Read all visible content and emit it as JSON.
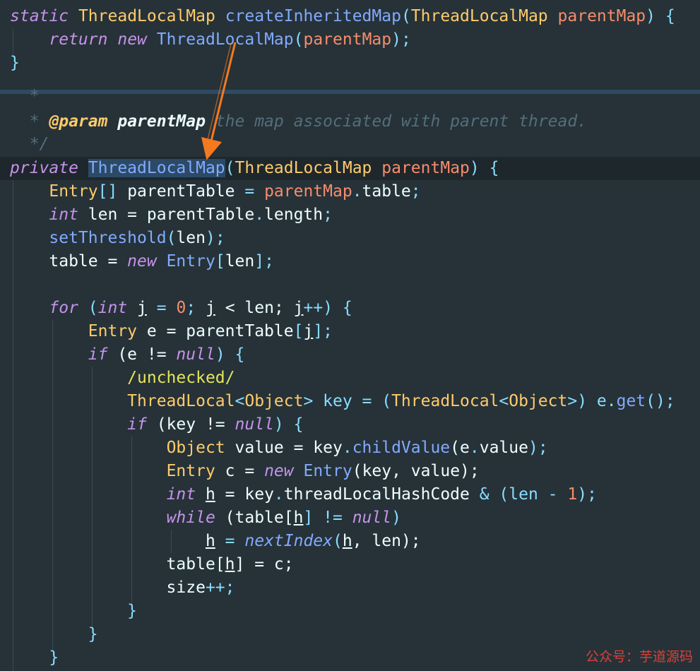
{
  "editor": {
    "theme_colors": {
      "background": "#263238",
      "keyword": "#c792ea",
      "type": "#ffcb6b",
      "function": "#82aaff",
      "param": "#f78c6c",
      "operator": "#89ddff",
      "comment": "#546e7a",
      "arrow": "#f4791f"
    },
    "lines": {
      "l1": {
        "a": "static",
        "b": " ",
        "c": "ThreadLocalMap",
        "d": " ",
        "e": "createInheritedMap",
        "f": "(",
        "g": "ThreadLocalMap",
        "h": " ",
        "i": "parentMap",
        "j": ") {"
      },
      "l2": {
        "a": "    ",
        "b": "return",
        "c": " ",
        "d": "new",
        "e": " ",
        "f": "ThreadLocalMap",
        "g": "(",
        "h": "parentMap",
        "i": ");"
      },
      "l3": {
        "a": "}"
      },
      "l4": {
        "a": "  *"
      },
      "l5": {
        "a": "  * ",
        "b": "@param",
        "c": " ",
        "d": "parentMap",
        "e": " the map associated with parent thread."
      },
      "l6": {
        "a": "  */"
      },
      "l7": {
        "a": "private",
        "b": " ",
        "c": "ThreadLocalMap",
        "d": "(",
        "e": "ThreadLocalMap",
        "f": " ",
        "g": "parentMap",
        "h": ") {"
      },
      "l8": {
        "a": "    ",
        "b": "Entry",
        "c": "[] ",
        "d": "parentTable",
        "e": " = ",
        "f": "parentMap",
        "g": ".",
        "h": "table",
        "i": ";"
      },
      "l9": {
        "a": "    ",
        "b": "int",
        "c": " len = parentTable",
        "d": ".",
        "e": "length",
        "f": ";"
      },
      "l10": {
        "a": "    ",
        "b": "setThreshold",
        "c": "(",
        "d": "len",
        "e": ");"
      },
      "l11": {
        "a": "    table = ",
        "b": "new",
        "c": " ",
        "d": "Entry",
        "e": "[",
        "f": "len",
        "g": "];"
      },
      "l13": {
        "a": "    ",
        "b": "for",
        "c": " (",
        "d": "int",
        "e": " ",
        "f": "j",
        "g": " = ",
        "h": "0",
        "i": "; ",
        "j": "j",
        "k": " < len; ",
        "l": "j",
        "m": "++) {"
      },
      "l14": {
        "a": "        ",
        "b": "Entry",
        "c": " e = parentTable",
        "d": "[",
        "e": "j",
        "f": "];"
      },
      "l15": {
        "a": "        ",
        "b": "if",
        "c": " (e != ",
        "d": "null",
        "e": ") {"
      },
      "l16": {
        "a": "            ",
        "b": "/unchecked/"
      },
      "l17": {
        "a": "            ",
        "b": "ThreadLocal",
        "c": "<",
        "d": "Object",
        "e": "> key = (",
        "f": "ThreadLocal",
        "g": "<",
        "h": "Object",
        "i": ">) e",
        "j": ".",
        "k": "get",
        "l": "();"
      },
      "l18": {
        "a": "            ",
        "b": "if",
        "c": " (key != ",
        "d": "null",
        "e": ") {"
      },
      "l19": {
        "a": "                ",
        "b": "Object",
        "c": " value = key",
        "d": ".",
        "e": "childValue",
        "f": "(e",
        "g": ".",
        "h": "value",
        "i": ");"
      },
      "l20": {
        "a": "                ",
        "b": "Entry",
        "c": " c = ",
        "d": "new",
        "e": " ",
        "f": "Entry",
        "g": "(key, value);"
      },
      "l21": {
        "a": "                ",
        "b": "int",
        "c": " ",
        "d": "h",
        "e": " = key",
        "f": ".",
        "g": "threadLocalHashCode",
        "h": " & (len - ",
        "i": "1",
        "j": ");"
      },
      "l22": {
        "a": "                ",
        "b": "while",
        "c": " (table[",
        "d": "h",
        "e": "] != ",
        "f": "null",
        "g": ")"
      },
      "l23": {
        "a": "                    ",
        "b": "h",
        "c": " = ",
        "d": "nextIndex",
        "e": "(",
        "f": "h",
        "g": ", len);"
      },
      "l24": {
        "a": "                table[",
        "b": "h",
        "c": "] = c;"
      },
      "l25": {
        "a": "                size",
        "b": "++;"
      },
      "l26": {
        "a": "            }"
      },
      "l27": {
        "a": "        }"
      },
      "l28": {
        "a": "    }"
      }
    }
  },
  "watermark": "公众号：芋道源码"
}
